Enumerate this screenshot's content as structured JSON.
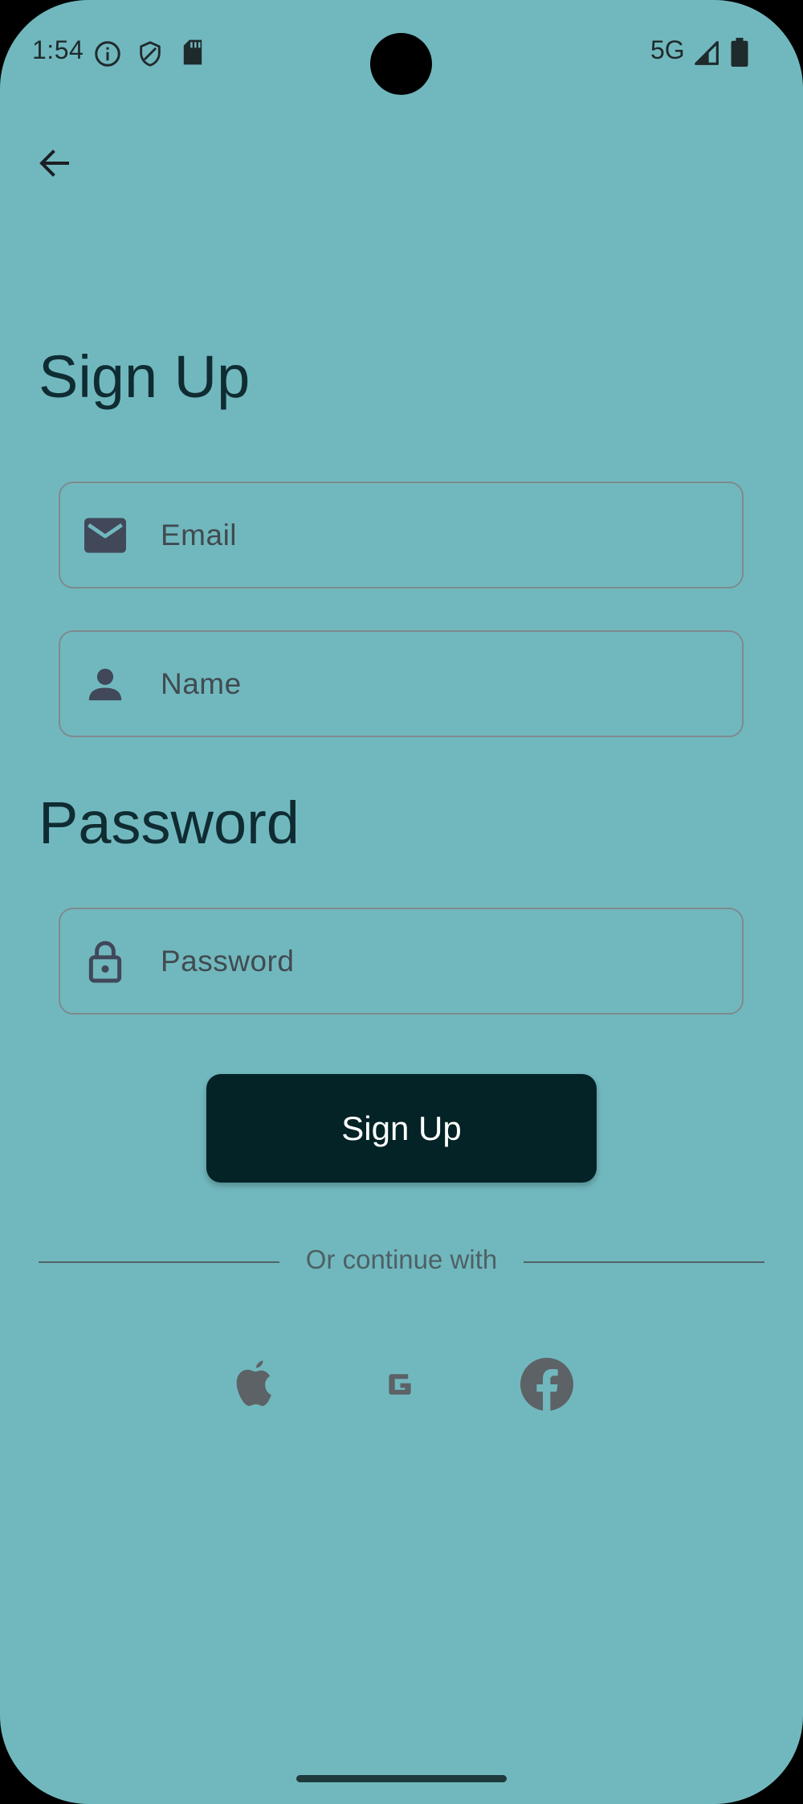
{
  "status_bar": {
    "time": "1:54",
    "network": "5G",
    "icons": [
      "info-icon",
      "shield-icon",
      "sd-card-icon",
      "signal-icon",
      "battery-icon"
    ]
  },
  "nav": {
    "back_icon": "arrow-left-icon"
  },
  "signup_section": {
    "title": "Sign Up",
    "email": {
      "placeholder": "Email",
      "value": "",
      "icon": "mail-icon"
    },
    "name": {
      "placeholder": "Name",
      "value": "",
      "icon": "person-icon"
    }
  },
  "password_section": {
    "title": "Password",
    "password": {
      "placeholder": "Password",
      "value": "",
      "icon": "lock-icon"
    }
  },
  "actions": {
    "signup_label": "Sign Up"
  },
  "social": {
    "divider_text": "Or continue with",
    "providers": [
      "apple-icon",
      "google-icon",
      "facebook-icon"
    ]
  },
  "colors": {
    "background": "#71b8be",
    "primary_button": "#042326",
    "title_text": "#0f2c32",
    "field_border": "#7e8a8e",
    "social_icon": "#5c6266"
  }
}
